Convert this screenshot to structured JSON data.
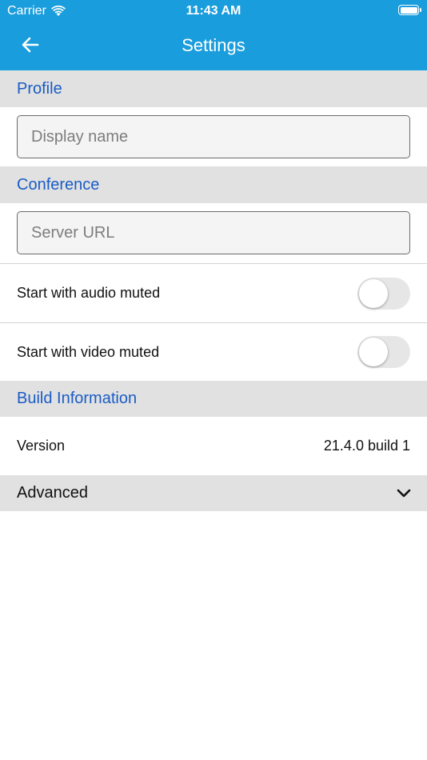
{
  "status_bar": {
    "carrier": "Carrier",
    "time": "11:43 AM"
  },
  "header": {
    "title": "Settings"
  },
  "profile": {
    "section_title": "Profile",
    "display_name_placeholder": "Display name",
    "display_name_value": ""
  },
  "conference": {
    "section_title": "Conference",
    "server_url_placeholder": "Server URL",
    "server_url_value": "",
    "audio_muted_label": "Start with audio muted",
    "audio_muted": false,
    "video_muted_label": "Start with video muted",
    "video_muted": false
  },
  "build": {
    "section_title": "Build Information",
    "version_label": "Version",
    "version_value": "21.4.0 build 1"
  },
  "advanced": {
    "label": "Advanced"
  },
  "colors": {
    "header_bg": "#1a9ddc",
    "section_bg": "#e1e1e1",
    "section_text": "#1a5cc5"
  },
  "icons": {
    "back": "arrow-left-icon",
    "wifi": "wifi-icon",
    "battery": "battery-icon",
    "expand": "chevron-down-icon"
  }
}
